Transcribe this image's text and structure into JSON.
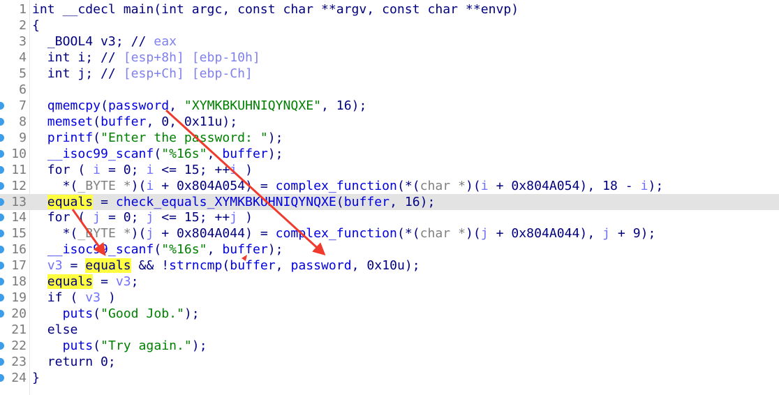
{
  "colors": {
    "keyword": "#000080",
    "function": "#0000e0",
    "local_var": "#7070ff",
    "comment": "#8080f0",
    "string": "#008000",
    "type": "#808080",
    "highlight": "#ffff40",
    "current_line": "#e3e3e3",
    "breakpoint": "#3c9ee8",
    "arrow": "#f03a2e"
  },
  "current_line": 13,
  "lines": [
    {
      "n": "1",
      "bp": false,
      "t": [
        [
          "k",
          "int __cdecl main(int argc, const char **argv, const char **envp)"
        ]
      ]
    },
    {
      "n": "2",
      "bp": false,
      "t": [
        [
          "k",
          "{"
        ]
      ]
    },
    {
      "n": "3",
      "bp": false,
      "t": [
        [
          "k",
          "  _BOOL4 v3; // "
        ],
        [
          "c",
          "eax"
        ]
      ]
    },
    {
      "n": "4",
      "bp": false,
      "t": [
        [
          "k",
          "  int i; // "
        ],
        [
          "c",
          "[esp+8h] [ebp-10h]"
        ]
      ]
    },
    {
      "n": "5",
      "bp": false,
      "t": [
        [
          "k",
          "  int j; // "
        ],
        [
          "c",
          "[esp+Ch] [ebp-Ch]"
        ]
      ]
    },
    {
      "n": "6",
      "bp": false,
      "t": []
    },
    {
      "n": "7",
      "bp": true,
      "t": [
        [
          "k",
          "  "
        ],
        [
          "f",
          "qmemcpy"
        ],
        [
          "k",
          "("
        ],
        [
          "f",
          "password"
        ],
        [
          "k",
          ", "
        ],
        [
          "s",
          "\"XYMKBKUHNIQYNQXE\""
        ],
        [
          "k",
          ", 16);"
        ]
      ]
    },
    {
      "n": "8",
      "bp": true,
      "t": [
        [
          "k",
          "  "
        ],
        [
          "f",
          "memset"
        ],
        [
          "k",
          "("
        ],
        [
          "f",
          "buffer"
        ],
        [
          "k",
          ", 0, 0x11u);"
        ]
      ]
    },
    {
      "n": "9",
      "bp": true,
      "t": [
        [
          "k",
          "  "
        ],
        [
          "f",
          "printf"
        ],
        [
          "k",
          "("
        ],
        [
          "s",
          "\"Enter the password: \""
        ],
        [
          "k",
          ");"
        ]
      ]
    },
    {
      "n": "10",
      "bp": true,
      "t": [
        [
          "k",
          "  "
        ],
        [
          "f",
          "__isoc99_scanf"
        ],
        [
          "k",
          "("
        ],
        [
          "s",
          "\"%16s\""
        ],
        [
          "k",
          ", "
        ],
        [
          "f",
          "buffer"
        ],
        [
          "k",
          ");"
        ]
      ]
    },
    {
      "n": "11",
      "bp": true,
      "t": [
        [
          "k",
          "  for ( "
        ],
        [
          "v",
          "i"
        ],
        [
          "k",
          " = 0; "
        ],
        [
          "v",
          "i"
        ],
        [
          "k",
          " <= 15; ++"
        ],
        [
          "v",
          "i"
        ],
        [
          "k",
          " )"
        ]
      ]
    },
    {
      "n": "12",
      "bp": true,
      "t": [
        [
          "k",
          "    *("
        ],
        [
          "t",
          "_BYTE *"
        ],
        [
          "k",
          ")("
        ],
        [
          "v",
          "i"
        ],
        [
          "k",
          " + 0x804A054) = "
        ],
        [
          "f",
          "complex_function"
        ],
        [
          "k",
          "(*("
        ],
        [
          "t",
          "char *"
        ],
        [
          "k",
          ")("
        ],
        [
          "v",
          "i"
        ],
        [
          "k",
          " + 0x804A054), 18 - "
        ],
        [
          "v",
          "i"
        ],
        [
          "k",
          ");"
        ]
      ]
    },
    {
      "n": "13",
      "bp": true,
      "t": [
        [
          "k",
          "  "
        ],
        [
          "h",
          "equals"
        ],
        [
          "k",
          " = "
        ],
        [
          "f",
          "check_equals_XYMKBKUHNIQYNQXE"
        ],
        [
          "k",
          "("
        ],
        [
          "f",
          "buffer"
        ],
        [
          "k",
          ", 16);"
        ]
      ]
    },
    {
      "n": "14",
      "bp": true,
      "t": [
        [
          "k",
          "  for ( "
        ],
        [
          "v",
          "j"
        ],
        [
          "k",
          " = 0; "
        ],
        [
          "v",
          "j"
        ],
        [
          "k",
          " <= 15; ++"
        ],
        [
          "v",
          "j"
        ],
        [
          "k",
          " )"
        ]
      ]
    },
    {
      "n": "15",
      "bp": true,
      "t": [
        [
          "k",
          "    *("
        ],
        [
          "t",
          "_BYTE *"
        ],
        [
          "k",
          ")("
        ],
        [
          "v",
          "j"
        ],
        [
          "k",
          " + 0x804A044) = "
        ],
        [
          "f",
          "complex_function"
        ],
        [
          "k",
          "(*("
        ],
        [
          "t",
          "char *"
        ],
        [
          "k",
          ")("
        ],
        [
          "v",
          "j"
        ],
        [
          "k",
          " + 0x804A044), "
        ],
        [
          "v",
          "j"
        ],
        [
          "k",
          " + 9);"
        ]
      ]
    },
    {
      "n": "16",
      "bp": true,
      "t": [
        [
          "k",
          "  "
        ],
        [
          "f",
          "__isoc99_scanf"
        ],
        [
          "k",
          "("
        ],
        [
          "s",
          "\"%16s\""
        ],
        [
          "k",
          ", "
        ],
        [
          "f",
          "buffer"
        ],
        [
          "k",
          ");"
        ]
      ]
    },
    {
      "n": "17",
      "bp": true,
      "t": [
        [
          "k",
          "  "
        ],
        [
          "v",
          "v3"
        ],
        [
          "k",
          " = "
        ],
        [
          "h",
          "equals"
        ],
        [
          "k",
          " && !"
        ],
        [
          "f",
          "strncmp"
        ],
        [
          "k",
          "("
        ],
        [
          "f",
          "buffer"
        ],
        [
          "k",
          ", "
        ],
        [
          "f",
          "password"
        ],
        [
          "k",
          ", 0x10u);"
        ]
      ]
    },
    {
      "n": "18",
      "bp": true,
      "t": [
        [
          "k",
          "  "
        ],
        [
          "h",
          "equals"
        ],
        [
          "k",
          " = "
        ],
        [
          "v",
          "v3"
        ],
        [
          "k",
          ";"
        ]
      ]
    },
    {
      "n": "19",
      "bp": true,
      "t": [
        [
          "k",
          "  if ( "
        ],
        [
          "v",
          "v3"
        ],
        [
          "k",
          " )"
        ]
      ]
    },
    {
      "n": "20",
      "bp": true,
      "t": [
        [
          "k",
          "    "
        ],
        [
          "f",
          "puts"
        ],
        [
          "k",
          "("
        ],
        [
          "s",
          "\"Good Job.\""
        ],
        [
          "k",
          ");"
        ]
      ]
    },
    {
      "n": "21",
      "bp": false,
      "t": [
        [
          "k",
          "  else"
        ]
      ]
    },
    {
      "n": "22",
      "bp": true,
      "t": [
        [
          "k",
          "    "
        ],
        [
          "f",
          "puts"
        ],
        [
          "k",
          "("
        ],
        [
          "s",
          "\"Try again.\""
        ],
        [
          "k",
          ");"
        ]
      ]
    },
    {
      "n": "23",
      "bp": true,
      "t": [
        [
          "k",
          "  return 0;"
        ]
      ]
    },
    {
      "n": "24",
      "bp": true,
      "t": [
        [
          "k",
          "}"
        ]
      ]
    }
  ]
}
